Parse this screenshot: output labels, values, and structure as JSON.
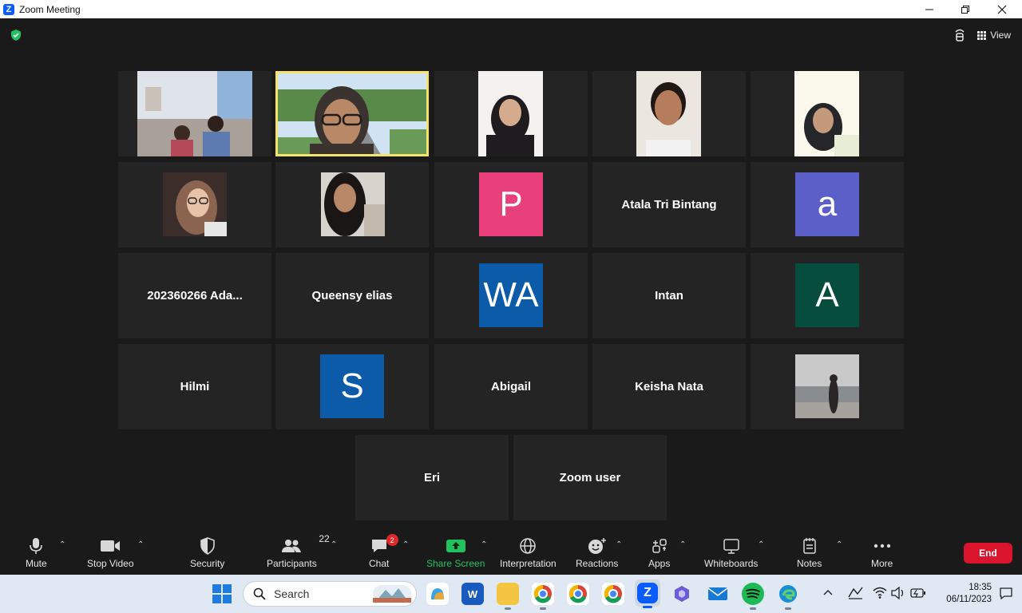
{
  "window": {
    "title": "Zoom Meeting"
  },
  "header": {
    "view_label": "View"
  },
  "participants_grid": [
    {
      "type": "video"
    },
    {
      "type": "video"
    },
    {
      "type": "video"
    },
    {
      "type": "video"
    },
    {
      "type": "video"
    },
    {
      "type": "video"
    },
    {
      "type": "video"
    },
    {
      "type": "avatar",
      "letter": "P",
      "color": "#e8407a"
    },
    {
      "type": "name",
      "name": "Atala Tri Bintang"
    },
    {
      "type": "avatar",
      "letter": "a",
      "color": "#5b5fc7"
    },
    {
      "type": "name",
      "name": "202360266 Ada..."
    },
    {
      "type": "name",
      "name": "Queensy elias"
    },
    {
      "type": "avatar",
      "letter": "WA",
      "color": "#0b5ba8"
    },
    {
      "type": "name",
      "name": "Intan"
    },
    {
      "type": "avatar",
      "letter": "A",
      "color": "#064d3d"
    },
    {
      "type": "name",
      "name": "Hilmi"
    },
    {
      "type": "avatar",
      "letter": "S",
      "color": "#0b5ba8"
    },
    {
      "type": "name",
      "name": "Abigail"
    },
    {
      "type": "name",
      "name": "Keisha Nata"
    },
    {
      "type": "video"
    },
    {
      "type": "name",
      "name": "Eri"
    },
    {
      "type": "name",
      "name": "Zoom user"
    }
  ],
  "toolbar": {
    "mute": "Mute",
    "stop_video": "Stop Video",
    "security": "Security",
    "participants": "Participants",
    "participants_count": "22",
    "chat": "Chat",
    "chat_badge": "2",
    "share_screen": "Share Screen",
    "interpretation": "Interpretation",
    "reactions": "Reactions",
    "apps": "Apps",
    "whiteboards": "Whiteboards",
    "notes": "Notes",
    "more": "More",
    "end": "End"
  },
  "taskbar": {
    "search_placeholder": "Search",
    "time": "18:35",
    "date": "06/11/2023"
  },
  "colors": {
    "accent_green": "#21c25e",
    "active_speaker_border": "#f5e36d",
    "end_red": "#d9142c"
  }
}
